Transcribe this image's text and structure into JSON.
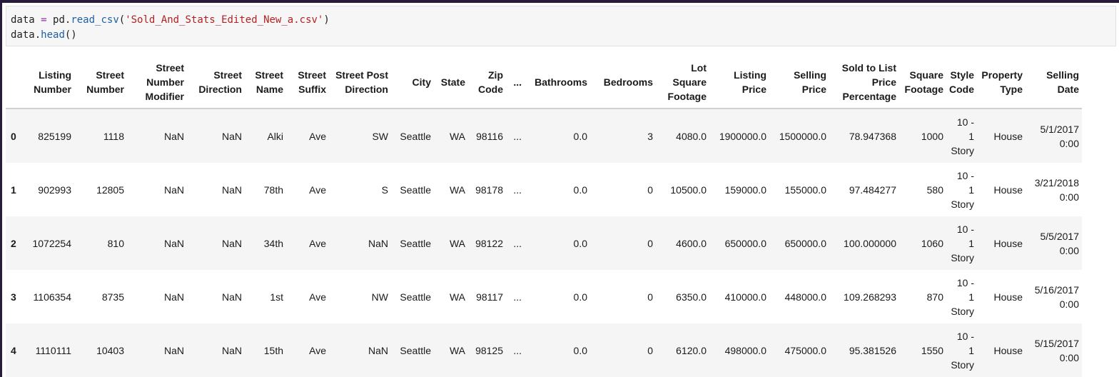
{
  "code": {
    "line1": {
      "var": "data",
      "op": "=",
      "obj": "pd.",
      "fn": "read_csv",
      "open": "(",
      "arg": "'Sold_And_Stats_Edited_New_a.csv'",
      "close": ")"
    },
    "line2": {
      "obj": "data.",
      "fn": "head",
      "parens": "()"
    }
  },
  "table": {
    "columns": [
      "Listing Number",
      "Street Number",
      "Street Number Modifier",
      "Street Direction",
      "Street Name",
      "Street Suffix",
      "Street Post Direction",
      "City",
      "State",
      "Zip Code",
      "...",
      "Bathrooms",
      "Bedrooms",
      "Lot Square Footage",
      "Listing Price",
      "Selling Price",
      "Sold to List Price Percentage",
      "Square Footage",
      "Style Code",
      "Property Type",
      "Selling Date"
    ],
    "index": [
      "0",
      "1",
      "2",
      "3",
      "4"
    ],
    "rows": [
      [
        "825199",
        "1118",
        "NaN",
        "NaN",
        "Alki",
        "Ave",
        "SW",
        "Seattle",
        "WA",
        "98116",
        "...",
        "0.0",
        "3",
        "4080.0",
        "1900000.0",
        "1500000.0",
        "78.947368",
        "1000",
        "10 - 1 Story",
        "House",
        "5/1/2017 0:00"
      ],
      [
        "902993",
        "12805",
        "NaN",
        "NaN",
        "78th",
        "Ave",
        "S",
        "Seattle",
        "WA",
        "98178",
        "...",
        "0.0",
        "0",
        "10500.0",
        "159000.0",
        "155000.0",
        "97.484277",
        "580",
        "10 - 1 Story",
        "House",
        "3/21/2018 0:00"
      ],
      [
        "1072254",
        "810",
        "NaN",
        "NaN",
        "34th",
        "Ave",
        "NaN",
        "Seattle",
        "WA",
        "98122",
        "...",
        "0.0",
        "0",
        "4600.0",
        "650000.0",
        "650000.0",
        "100.000000",
        "1060",
        "10 - 1 Story",
        "House",
        "5/5/2017 0:00"
      ],
      [
        "1106354",
        "8735",
        "NaN",
        "NaN",
        "1st",
        "Ave",
        "NW",
        "Seattle",
        "WA",
        "98117",
        "...",
        "0.0",
        "0",
        "6350.0",
        "410000.0",
        "448000.0",
        "109.268293",
        "870",
        "10 - 1 Story",
        "House",
        "5/16/2017 0:00"
      ],
      [
        "1110111",
        "10403",
        "NaN",
        "NaN",
        "15th",
        "Ave",
        "NaN",
        "Seattle",
        "WA",
        "98125",
        "...",
        "0.0",
        "0",
        "6120.0",
        "498000.0",
        "475000.0",
        "95.381526",
        "1550",
        "10 - 1 Story",
        "House",
        "5/15/2017 0:00"
      ]
    ]
  }
}
